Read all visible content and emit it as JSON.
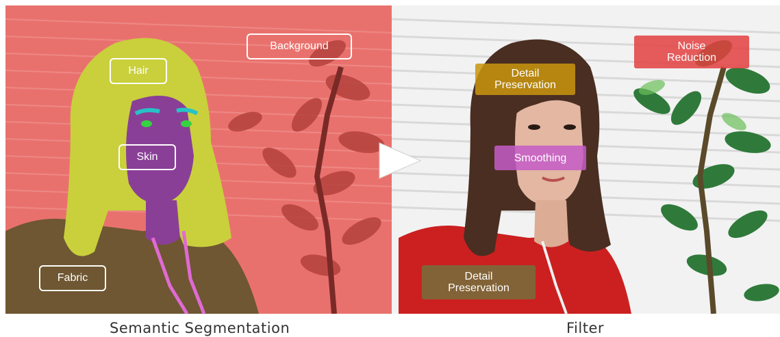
{
  "left_panel": {
    "labels": {
      "hair": "Hair",
      "background": "Background",
      "skin": "Skin",
      "fabric": "Fabric"
    },
    "caption": "Semantic Segmentation"
  },
  "right_panel": {
    "labels": {
      "detail_top": "Detail\nPreservation",
      "noise": "Noise\nReduction",
      "smoothing": "Smoothing",
      "detail_bottom": "Detail\nPreservation"
    },
    "caption": "Filter"
  },
  "colors": {
    "background_mask": "#e8716e",
    "hair_mask": "#c8cf3a",
    "skin_mask": "#8a3f96",
    "fabric_mask": "#6f5a32",
    "detail_label": "#c9950e",
    "noise_label": "#e34040",
    "smoothing_label": "#c45cc8",
    "detail_bottom_label": "#7a6a3a"
  }
}
